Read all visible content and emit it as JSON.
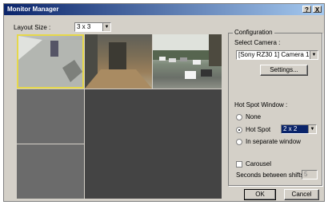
{
  "window": {
    "title": "Monitor Manager",
    "help_label": "?",
    "close_label": "X"
  },
  "layout": {
    "label": "Layout Size :",
    "value": "3 x 3"
  },
  "configuration": {
    "group_label": "Configuration",
    "select_camera_label": "Select Camera :",
    "camera_value": "[Sony RZ30 1] Camera 1",
    "settings_label": "Settings..."
  },
  "hotspot": {
    "group_label": "Hot Spot Window :",
    "option_none": "None",
    "option_hotspot": "Hot Spot",
    "hotspot_value": "2 x 2",
    "option_separate": "In separate window",
    "selected": "Hot Spot"
  },
  "carousel": {
    "label": "Carousel",
    "checked": false,
    "seconds_label": "Seconds between shifts:",
    "seconds_value": "5"
  },
  "buttons": {
    "ok": "OK",
    "cancel": "Cancel"
  },
  "cameras": [
    {
      "name": "camera-view-1",
      "scene": "hallway"
    },
    {
      "name": "camera-view-2",
      "scene": "room"
    },
    {
      "name": "camera-view-3",
      "scene": "parking-lot"
    }
  ]
}
